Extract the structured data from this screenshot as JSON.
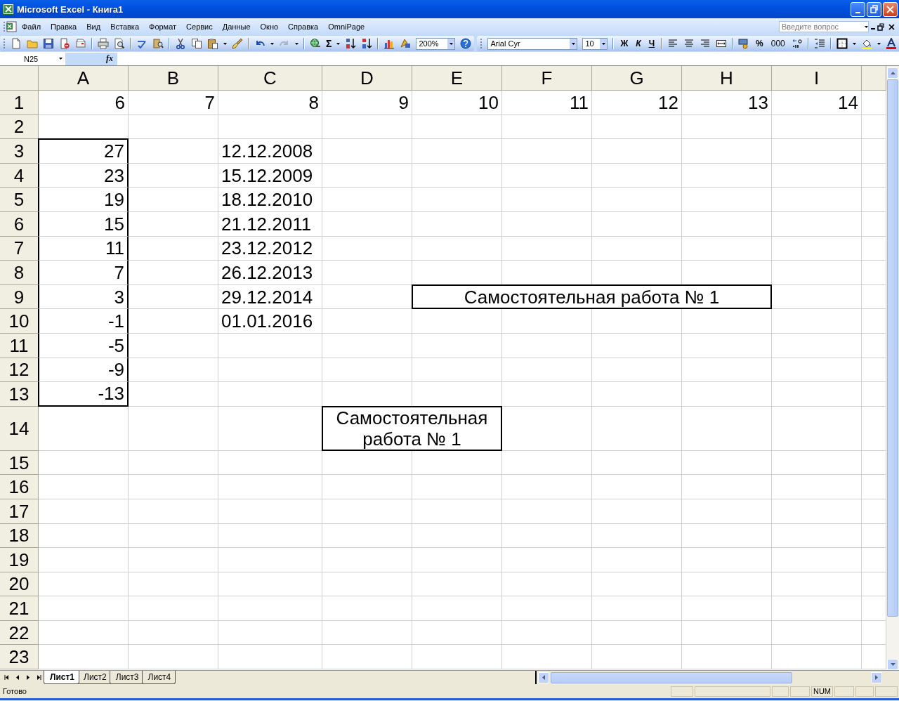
{
  "window": {
    "title": "Microsoft Excel - Книга1"
  },
  "menu": {
    "items": [
      "Файл",
      "Правка",
      "Вид",
      "Вставка",
      "Формат",
      "Сервис",
      "Данные",
      "Окно",
      "Справка",
      "OmniPage"
    ],
    "help_placeholder": "Введите вопрос"
  },
  "standard_toolbar": {
    "sum_symbol": "Σ",
    "zoom": "200%"
  },
  "formatting_toolbar": {
    "font": "Arial Cyr",
    "size": "10",
    "bold": "Ж",
    "italic": "К",
    "underline": "Ч",
    "percent": "%",
    "thousands": "000"
  },
  "formula_bar": {
    "name_box": "N25",
    "function_label": "fx"
  },
  "sheet": {
    "columns": [
      "A",
      "B",
      "C",
      "D",
      "E",
      "F",
      "G",
      "H",
      "I"
    ],
    "rows": [
      {
        "label": "1",
        "cells": [
          {
            "kind": "number",
            "value": "6"
          },
          {
            "kind": "number",
            "value": "7"
          },
          {
            "kind": "number",
            "value": "8"
          },
          {
            "kind": "number",
            "value": "9"
          },
          {
            "kind": "number",
            "value": "10"
          },
          {
            "kind": "number",
            "value": "11"
          },
          {
            "kind": "number",
            "value": "12"
          },
          {
            "kind": "number",
            "value": "13"
          },
          {
            "kind": "number",
            "value": "14"
          }
        ]
      },
      {
        "label": "2",
        "cells": []
      },
      {
        "label": "3",
        "cells": [
          {
            "kind": "number",
            "value": "27",
            "outlined": true
          },
          null,
          {
            "kind": "text",
            "value": "12.12.2008"
          }
        ]
      },
      {
        "label": "4",
        "cells": [
          {
            "kind": "number",
            "value": "23",
            "outlined": true
          },
          null,
          {
            "kind": "text",
            "value": "15.12.2009"
          }
        ]
      },
      {
        "label": "5",
        "cells": [
          {
            "kind": "number",
            "value": "19",
            "outlined": true
          },
          null,
          {
            "kind": "text",
            "value": "18.12.2010"
          }
        ]
      },
      {
        "label": "6",
        "cells": [
          {
            "kind": "number",
            "value": "15",
            "outlined": true
          },
          null,
          {
            "kind": "text",
            "value": "21.12.2011"
          }
        ]
      },
      {
        "label": "7",
        "cells": [
          {
            "kind": "number",
            "value": "11",
            "outlined": true
          },
          null,
          {
            "kind": "text",
            "value": "23.12.2012"
          }
        ]
      },
      {
        "label": "8",
        "cells": [
          {
            "kind": "number",
            "value": "7",
            "outlined": true
          },
          null,
          {
            "kind": "text",
            "value": "26.12.2013"
          }
        ]
      },
      {
        "label": "9",
        "cells": [
          {
            "kind": "number",
            "value": "3",
            "outlined": true
          },
          null,
          {
            "kind": "text",
            "value": "29.12.2014"
          },
          null,
          {
            "kind": "merged",
            "value": "Самостоятельная работа № 1",
            "bordered": true
          },
          {
            "kind": "covered"
          },
          {
            "kind": "covered"
          },
          {
            "kind": "covered"
          }
        ]
      },
      {
        "label": "10",
        "cells": [
          {
            "kind": "number",
            "value": "-1",
            "outlined": true
          },
          null,
          {
            "kind": "text",
            "value": "01.01.2016"
          }
        ]
      },
      {
        "label": "11",
        "cells": [
          {
            "kind": "number",
            "value": "-5",
            "outlined": true
          }
        ]
      },
      {
        "label": "12",
        "cells": [
          {
            "kind": "number",
            "value": "-9",
            "outlined": true
          }
        ]
      },
      {
        "label": "13",
        "cells": [
          {
            "kind": "number",
            "value": "-13",
            "outlined": true
          }
        ]
      },
      {
        "label": "14",
        "cells": [
          null,
          null,
          null,
          {
            "kind": "merged",
            "value": "Самостоятельная работа № 1",
            "bordered": true
          },
          {
            "kind": "covered"
          }
        ]
      },
      {
        "label": "15",
        "cells": []
      },
      {
        "label": "16",
        "cells": []
      },
      {
        "label": "17",
        "cells": []
      },
      {
        "label": "18",
        "cells": []
      },
      {
        "label": "19",
        "cells": []
      },
      {
        "label": "20",
        "cells": []
      },
      {
        "label": "21",
        "cells": []
      },
      {
        "label": "22",
        "cells": []
      },
      {
        "label": "23",
        "cells": []
      }
    ]
  },
  "sheet_tabs": [
    {
      "label": "Лист1",
      "selected": true
    },
    {
      "label": "Лист2",
      "selected": false
    },
    {
      "label": "Лист3",
      "selected": false
    },
    {
      "label": "Лист4",
      "selected": false
    }
  ],
  "status_bar": {
    "status": "Готово",
    "indicators": [
      "NUM"
    ]
  }
}
